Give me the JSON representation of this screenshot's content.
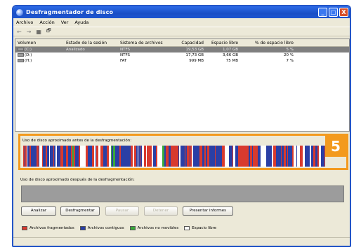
{
  "window": {
    "title": "Desfragmentador de disco",
    "controls": {
      "minimize": "_",
      "maximize": "□",
      "close": "X"
    }
  },
  "menu": [
    "Archivo",
    "Acción",
    "Ver",
    "Ayuda"
  ],
  "toolbar": {
    "back": "←",
    "forward": "→",
    "icon_a": "▦",
    "icon_b": "🗗"
  },
  "list": {
    "headers": {
      "volume": "Volumen",
      "status": "Estado de la sesión",
      "filesystem": "Sistema de archivos",
      "capacity": "Capacidad",
      "free": "Espacio libre",
      "pct_free": "% de espacio libre"
    },
    "rows": [
      {
        "volume": "(C:)",
        "status": "Analizado",
        "filesystem": "NTFS",
        "capacity": "19,53 GB",
        "free": "1,07 GB",
        "pct_free": "5 %"
      },
      {
        "volume": "(D:)",
        "status": "",
        "filesystem": "NTFS",
        "capacity": "17,73 GB",
        "free": "3,66 GB",
        "pct_free": "20 %"
      },
      {
        "volume": "(H:)",
        "status": "",
        "filesystem": "FAT",
        "capacity": "999 MB",
        "free": "75 MB",
        "pct_free": "7 %"
      }
    ]
  },
  "before": {
    "label": "Uso de disco aproximado antes de la desfragmentación:",
    "badge": "5"
  },
  "after": {
    "label": "Uso de disco aproximado después de la desfragmentación:"
  },
  "buttons": {
    "analyze": "Analizar",
    "defrag": "Desfragmentar",
    "pause": "Pausar",
    "stop": "Detener",
    "report": "Presentar informes"
  },
  "legend": [
    {
      "label": "Archivos fragmentados",
      "color": "#d83a2e"
    },
    {
      "label": "Archivos contiguos",
      "color": "#2a3fa5"
    },
    {
      "label": "Archivos no movibles",
      "color": "#3aa83a"
    },
    {
      "label": "Espacio libre",
      "color": "#ffffff"
    }
  ],
  "colors": {
    "fragmented": "#d83a2e",
    "contiguous": "#2a3fa5",
    "unmovable": "#3aa83a",
    "free": "#ffffff",
    "highlight": "#f39a1e"
  }
}
